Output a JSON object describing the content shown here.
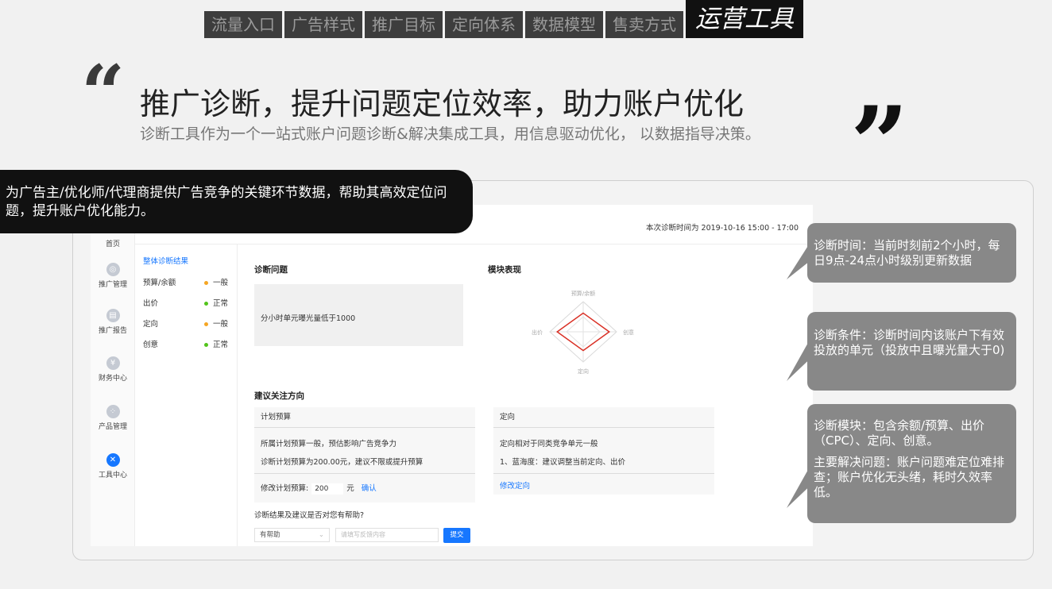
{
  "topnav": {
    "tabs": [
      "流量入口",
      "广告样式",
      "推广目标",
      "定向体系",
      "数据模型",
      "售卖方式"
    ],
    "active": "运营工具"
  },
  "headline": {
    "title": "推广诊断，提升问题定位效率，助力账户优化",
    "subtitle": "诊断工具作为一个一站式账户问题诊断&解决集成工具，用信息驱动优化， 以数据指导决策。"
  },
  "black_callout": "为广告主/优化师/代理商提供广告竞争的关键环节数据，帮助其高效定位问题，提升账户优化能力。",
  "sidebar": {
    "items": [
      {
        "label": "首页",
        "icon": "home-icon",
        "glyph": "⌂"
      },
      {
        "label": "推广管理",
        "icon": "promotion-icon",
        "glyph": "◎"
      },
      {
        "label": "推广报告",
        "icon": "report-icon",
        "glyph": "▤"
      },
      {
        "label": "财务中心",
        "icon": "yen-icon",
        "glyph": "¥"
      },
      {
        "label": "产品管理",
        "icon": "grid-icon",
        "glyph": "⁘"
      },
      {
        "label": "工具中心",
        "icon": "tool-icon",
        "glyph": "✕"
      }
    ]
  },
  "header": {
    "diagnosis_time": "本次诊断时间为 2019-10-16 15:00 - 17:00"
  },
  "result": {
    "title": "整体诊断结果",
    "rows": [
      {
        "label": "预算/余额",
        "status": "一般",
        "color": "#f5a623"
      },
      {
        "label": "出价",
        "status": "正常",
        "color": "#52c41a"
      },
      {
        "label": "定向",
        "status": "一般",
        "color": "#f5a623"
      },
      {
        "label": "创意",
        "status": "正常",
        "color": "#52c41a"
      }
    ]
  },
  "problem": {
    "title": "诊断问题",
    "text": "分小时单元曝光量低于1000"
  },
  "module": {
    "title": "模块表现",
    "axes": {
      "top": "预算/余额",
      "right": "创意",
      "bottom": "定向",
      "left": "出价"
    },
    "values": {
      "top": 0.62,
      "right": 0.78,
      "bottom": 0.62,
      "left": 0.78
    },
    "line_color": "#d93025"
  },
  "suggest": {
    "title": "建议关注方向",
    "budget": {
      "header": "计划预算",
      "line1": "所属计划预算一般，预估影响广告竞争力",
      "line2": "诊断计划预算为200.00元，建议不限或提升预算",
      "modify_label": "修改计划预算:",
      "value": "200",
      "unit": "元",
      "confirm": "确认"
    },
    "targeting": {
      "header": "定向",
      "line1": "定向相对于同类竞争单元一般",
      "line2": "1、蓝海度：建议调整当前定向、出价",
      "modify": "修改定向"
    }
  },
  "feedback": {
    "question": "诊断结果及建议是否对您有帮助?",
    "selected": "有帮助",
    "placeholder": "请填写反馈内容",
    "submit": "提交"
  },
  "callouts": {
    "time": "诊断时间：当前时刻前2个小时，每日9点-24点小时级别更新数据",
    "condition": "诊断条件：诊断时间内该账户下有效投放的单元（投放中且曝光量大于0)",
    "modules": "诊断模块：包含余额/预算、出价（CPC）、定向、创意。",
    "solves": "主要解决问题：账户问题难定位难排查；账户优化无头绪，耗时久效率低。"
  }
}
